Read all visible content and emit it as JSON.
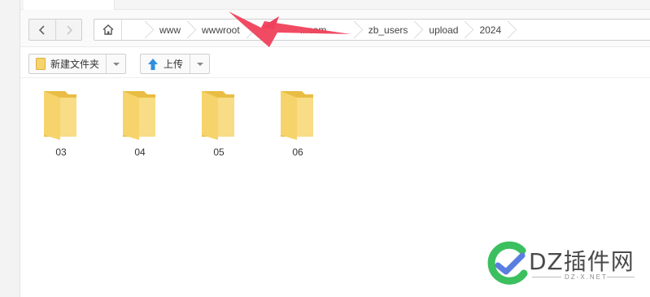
{
  "address_bar": {
    "crumbs": [
      "www",
      "wwwroot",
      "...com",
      "zb_users",
      "upload",
      "2024"
    ]
  },
  "toolbar": {
    "new_folder_label": "新建文件夹",
    "upload_label": "上传"
  },
  "folders": [
    {
      "name": "03"
    },
    {
      "name": "04"
    },
    {
      "name": "05"
    },
    {
      "name": "06"
    }
  ],
  "watermark": {
    "title": "DZ插件网",
    "subtitle": "DZ-X.NET"
  },
  "colors": {
    "folder": "#f6d36b",
    "folder_back": "#e9bd43",
    "upload_arrow": "#2f8fdc",
    "annotation_arrow": "#f0415c",
    "watermark_green": "#3bbf5f",
    "watermark_blue": "#5a7ee0"
  },
  "icons": {
    "back": "chevron-left-icon",
    "forward": "chevron-right-icon",
    "home": "home-icon",
    "new_folder": "folder-icon",
    "upload": "upload-arrow-icon"
  }
}
